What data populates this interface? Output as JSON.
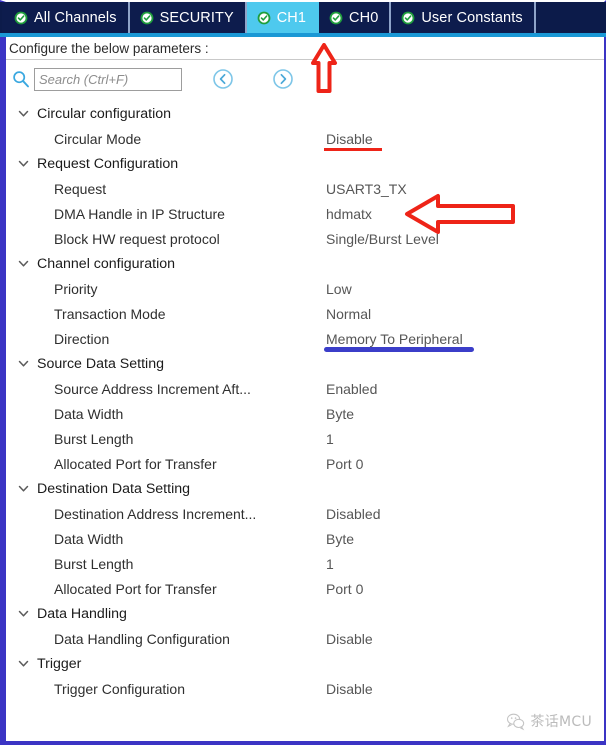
{
  "window": {
    "accent_border": "#3b34c4",
    "tabbar_bg": "#0c1b4a",
    "active_tab_bg": "#4ec9ee",
    "check_icon_color": "#1f9e3c"
  },
  "tabs": [
    {
      "label": "All Channels",
      "icon": "check-circle-icon",
      "active": false
    },
    {
      "label": "SECURITY",
      "icon": "check-circle-icon",
      "active": false
    },
    {
      "label": "CH1",
      "icon": "check-circle-icon",
      "active": true
    },
    {
      "label": "CH0",
      "icon": "check-circle-icon",
      "active": false
    },
    {
      "label": "User Constants",
      "icon": "check-circle-icon",
      "active": false
    }
  ],
  "header": {
    "configure_text": "Configure the below parameters :"
  },
  "search": {
    "icon": "search-icon",
    "value": "",
    "placeholder": "Search (Ctrl+F)",
    "prev_icon": "chevron-left-circle-icon",
    "next_icon": "chevron-right-circle-icon"
  },
  "tree": [
    {
      "kind": "group",
      "label": "Circular configuration",
      "expanded": true
    },
    {
      "kind": "param",
      "name": "Circular Mode",
      "value": "Disable",
      "highlight": "red"
    },
    {
      "kind": "group",
      "label": "Request Configuration",
      "expanded": true
    },
    {
      "kind": "param",
      "name": "Request",
      "value": "USART3_TX",
      "highlight": "none"
    },
    {
      "kind": "param",
      "name": "DMA Handle in IP Structure",
      "value": "hdmatx",
      "highlight": "none"
    },
    {
      "kind": "param",
      "name": "Block HW request protocol",
      "value": "Single/Burst Level",
      "highlight": "none"
    },
    {
      "kind": "group",
      "label": "Channel configuration",
      "expanded": true
    },
    {
      "kind": "param",
      "name": "Priority",
      "value": "Low",
      "highlight": "none"
    },
    {
      "kind": "param",
      "name": "Transaction Mode",
      "value": "Normal",
      "highlight": "none"
    },
    {
      "kind": "param",
      "name": "Direction",
      "value": "Memory To Peripheral",
      "highlight": "blue"
    },
    {
      "kind": "group",
      "label": "Source Data Setting",
      "expanded": true
    },
    {
      "kind": "param",
      "name": "Source Address Increment Aft...",
      "value": "Enabled",
      "highlight": "none"
    },
    {
      "kind": "param",
      "name": "Data Width",
      "value": "Byte",
      "highlight": "none"
    },
    {
      "kind": "param",
      "name": "Burst Length",
      "value": "1",
      "highlight": "none"
    },
    {
      "kind": "param",
      "name": "Allocated Port for Transfer",
      "value": "Port 0",
      "highlight": "none"
    },
    {
      "kind": "group",
      "label": "Destination Data Setting",
      "expanded": true
    },
    {
      "kind": "param",
      "name": "Destination Address Increment...",
      "value": "Disabled",
      "highlight": "none"
    },
    {
      "kind": "param",
      "name": "Data Width",
      "value": "Byte",
      "highlight": "none"
    },
    {
      "kind": "param",
      "name": "Burst Length",
      "value": "1",
      "highlight": "none"
    },
    {
      "kind": "param",
      "name": "Allocated Port for Transfer",
      "value": "Port 0",
      "highlight": "none"
    },
    {
      "kind": "group",
      "label": "Data Handling",
      "expanded": true
    },
    {
      "kind": "param",
      "name": "Data Handling Configuration",
      "value": "Disable",
      "highlight": "none"
    },
    {
      "kind": "group",
      "label": "Trigger",
      "expanded": true
    },
    {
      "kind": "param",
      "name": "Trigger Configuration",
      "value": "Disable",
      "highlight": "none"
    }
  ],
  "annotations": [
    {
      "name": "arrow-up-to-ch1-tab",
      "icon": "arrow-up-icon",
      "color": "#ee2418"
    },
    {
      "name": "arrow-left-to-dma-handle",
      "icon": "arrow-left-icon",
      "color": "#ee2418"
    }
  ],
  "watermark": {
    "icon": "wechat-icon",
    "text": "茶话MCU"
  }
}
